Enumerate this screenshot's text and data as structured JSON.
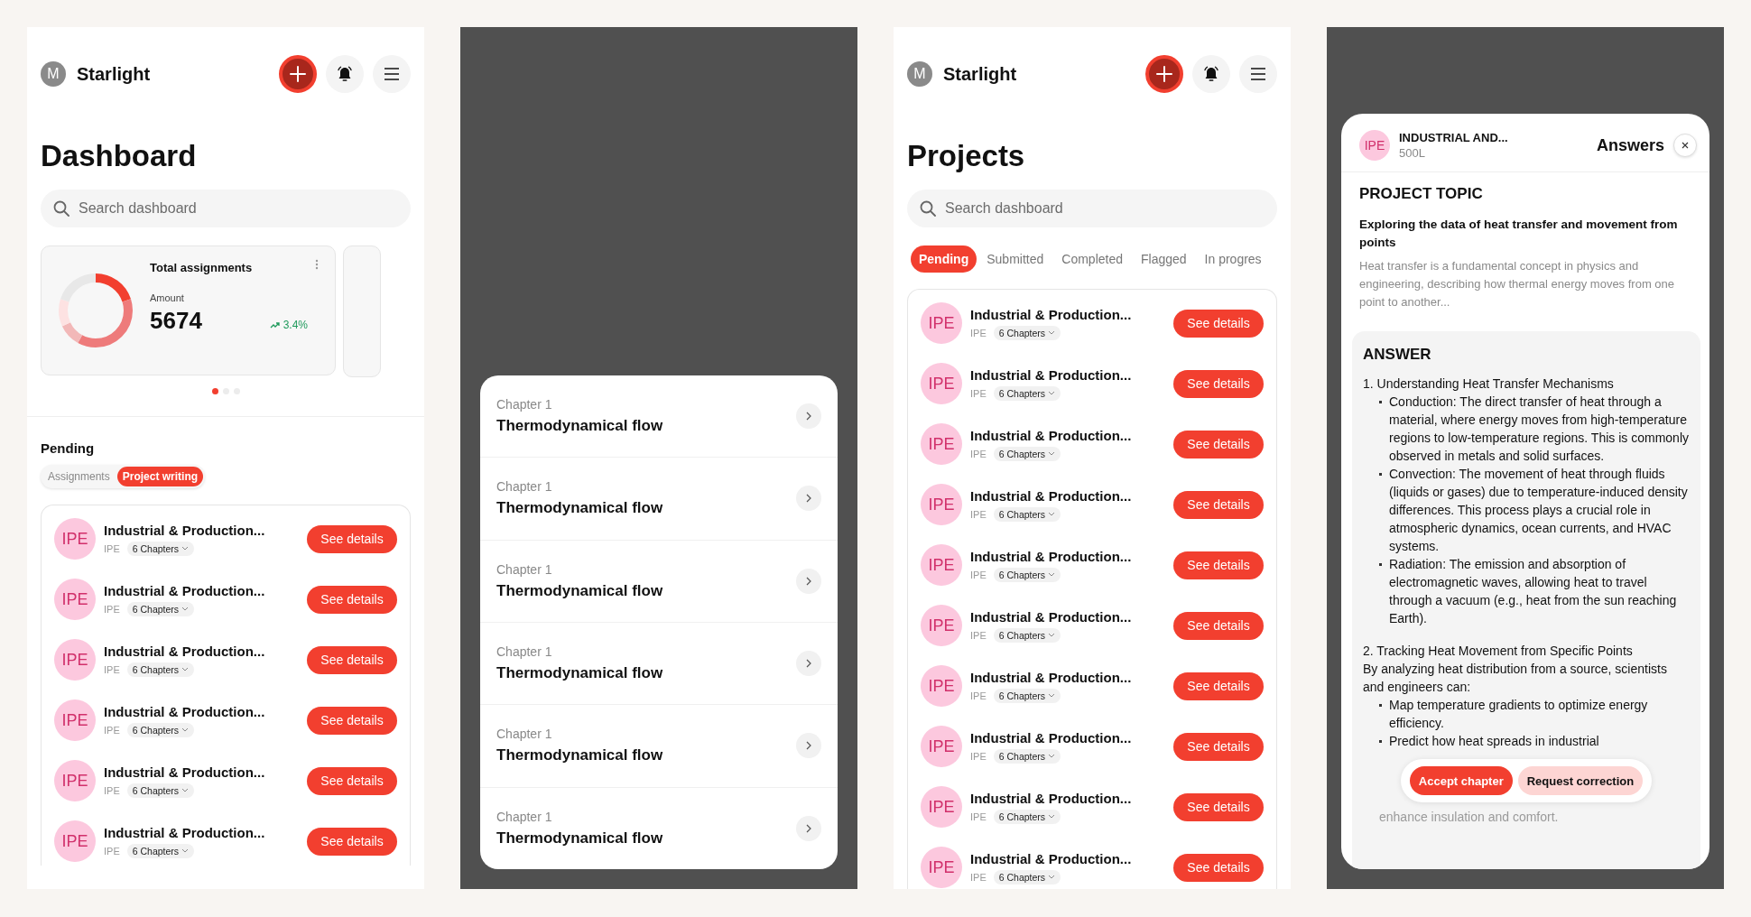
{
  "dashboard": {
    "header": {
      "avatar": "M",
      "title": "Starlight"
    },
    "title": "Dashboard",
    "search": {
      "placeholder": "Search dashboard"
    },
    "stat_card": {
      "title": "Total assignments",
      "label": "Amount",
      "value": "5674",
      "change": "3.4%"
    },
    "carousel_dots": [
      {
        "selected": true
      },
      {
        "selected": false
      },
      {
        "selected": false
      }
    ],
    "section_title": "Pending",
    "segments": [
      {
        "label": "Assignments",
        "selected": false
      },
      {
        "label": "Project writing",
        "selected": true
      }
    ],
    "items": [
      {
        "badge": "IPE",
        "title": "Industrial & Production...",
        "code": "IPE",
        "chapters": "6 Chapters",
        "action": "See details"
      },
      {
        "badge": "IPE",
        "title": "Industrial & Production...",
        "code": "IPE",
        "chapters": "6 Chapters",
        "action": "See details"
      },
      {
        "badge": "IPE",
        "title": "Industrial & Production...",
        "code": "IPE",
        "chapters": "6 Chapters",
        "action": "See details"
      },
      {
        "badge": "IPE",
        "title": "Industrial & Production...",
        "code": "IPE",
        "chapters": "6 Chapters",
        "action": "See details"
      },
      {
        "badge": "IPE",
        "title": "Industrial & Production...",
        "code": "IPE",
        "chapters": "6 Chapters",
        "action": "See details"
      },
      {
        "badge": "IPE",
        "title": "Industrial & Production...",
        "code": "IPE",
        "chapters": "6 Chapters",
        "action": "See details"
      }
    ]
  },
  "chapters_sheet": {
    "chapters": [
      {
        "label": "Chapter 1",
        "title": "Thermodynamical flow"
      },
      {
        "label": "Chapter 1",
        "title": "Thermodynamical flow"
      },
      {
        "label": "Chapter 1",
        "title": "Thermodynamical flow"
      },
      {
        "label": "Chapter 1",
        "title": "Thermodynamical flow"
      },
      {
        "label": "Chapter 1",
        "title": "Thermodynamical flow"
      },
      {
        "label": "Chapter 1",
        "title": "Thermodynamical flow"
      }
    ]
  },
  "projects": {
    "header": {
      "avatar": "M",
      "title": "Starlight"
    },
    "title": "Projects",
    "search": {
      "placeholder": "Search dashboard"
    },
    "tabs": [
      {
        "label": "Pending",
        "selected": true
      },
      {
        "label": "Submitted",
        "selected": false
      },
      {
        "label": "Completed",
        "selected": false
      },
      {
        "label": "Flagged",
        "selected": false
      },
      {
        "label": "In progres",
        "selected": false
      }
    ],
    "items": [
      {
        "badge": "IPE",
        "title": "Industrial & Production...",
        "code": "IPE",
        "chapters": "6 Chapters",
        "action": "See details"
      },
      {
        "badge": "IPE",
        "title": "Industrial & Production...",
        "code": "IPE",
        "chapters": "6 Chapters",
        "action": "See details"
      },
      {
        "badge": "IPE",
        "title": "Industrial & Production...",
        "code": "IPE",
        "chapters": "6 Chapters",
        "action": "See details"
      },
      {
        "badge": "IPE",
        "title": "Industrial & Production...",
        "code": "IPE",
        "chapters": "6 Chapters",
        "action": "See details"
      },
      {
        "badge": "IPE",
        "title": "Industrial & Production...",
        "code": "IPE",
        "chapters": "6 Chapters",
        "action": "See details"
      },
      {
        "badge": "IPE",
        "title": "Industrial & Production...",
        "code": "IPE",
        "chapters": "6 Chapters",
        "action": "See details"
      },
      {
        "badge": "IPE",
        "title": "Industrial & Production...",
        "code": "IPE",
        "chapters": "6 Chapters",
        "action": "See details"
      },
      {
        "badge": "IPE",
        "title": "Industrial & Production...",
        "code": "IPE",
        "chapters": "6 Chapters",
        "action": "See details"
      },
      {
        "badge": "IPE",
        "title": "Industrial & Production...",
        "code": "IPE",
        "chapters": "6 Chapters",
        "action": "See details"
      },
      {
        "badge": "IPE",
        "title": "Industrial & Production...",
        "code": "IPE",
        "chapters": "6 Chapters",
        "action": "See details"
      }
    ]
  },
  "answers": {
    "header": {
      "badge": "IPE",
      "title": "INDUSTRIAL AND...",
      "level": "500L",
      "heading": "Answers"
    },
    "topic_heading": "PROJECT TOPIC",
    "topic_title": "Exploring the data of heat transfer and movement from points",
    "topic_summary": "Heat transfer is a fundamental concept in physics and engineering, describing how thermal energy moves from one point to another...",
    "answer_heading": "ANSWER",
    "sections": [
      {
        "heading": "1. Understanding Heat Transfer Mechanisms",
        "bullets": [
          "Conduction: The direct transfer of heat through a material, where energy moves from high-temperature regions to low-temperature regions. This is commonly observed in metals and solid surfaces.",
          "Convection: The movement of heat through fluids (liquids or gases) due to temperature-induced density differences. This process plays a crucial role in atmospheric dynamics, ocean currents, and HVAC systems.",
          "Radiation: The emission and absorption of electromagnetic waves, allowing heat to travel through a vacuum (e.g., heat from the sun reaching Earth)."
        ]
      },
      {
        "heading": "2. Tracking Heat Movement from Specific Points",
        "intro": "By analyzing heat distribution from a source, scientists and engineers can:",
        "bullets": [
          "Map temperature gradients to optimize energy efficiency.",
          "Predict how heat spreads in industrial"
        ]
      }
    ],
    "actions": [
      {
        "label": "Accept chapter",
        "kind": "primary"
      },
      {
        "label": "Request correction",
        "kind": "secondary"
      }
    ],
    "faded_line": "enhance insulation and comfort."
  }
}
